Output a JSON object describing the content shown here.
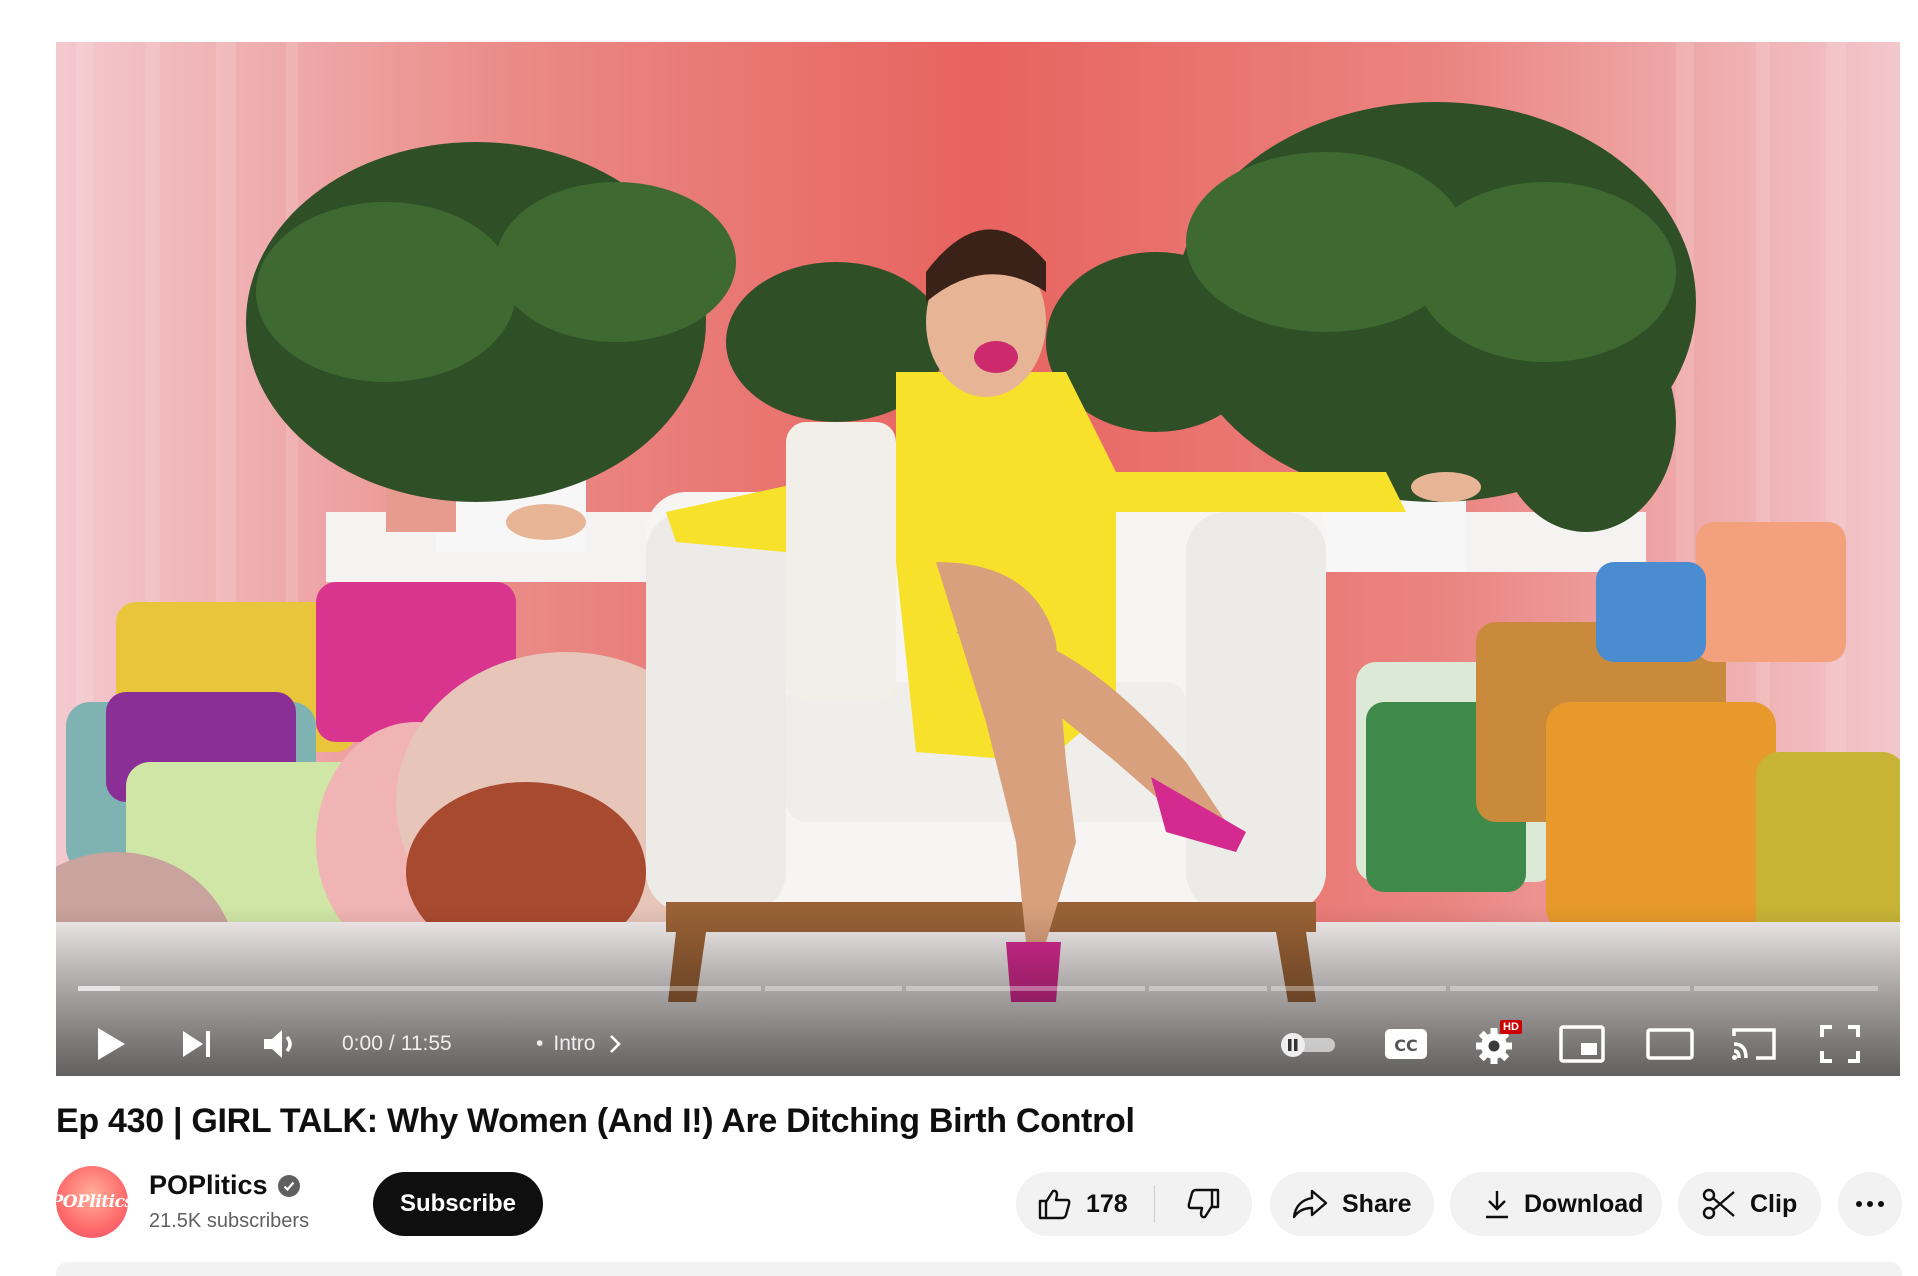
{
  "player": {
    "current_time": "0:00",
    "separator": "/",
    "duration": "11:55",
    "chapter_bullet": "•",
    "chapter": "Intro",
    "progress_played_fraction": 0.0,
    "settings_badge": "HD"
  },
  "video": {
    "title": "Ep 430 | GIRL TALK: Why Women (And I!) Are Ditching Birth Control"
  },
  "channel": {
    "name": "POPlitics",
    "subscribers": "21.5K subscribers",
    "avatar_text": "POPlitics",
    "verified": true
  },
  "actions": {
    "subscribe_label": "Subscribe",
    "like_count": "178",
    "share_label": "Share",
    "download_label": "Download",
    "clip_label": "Clip"
  },
  "icons": {
    "play": "play-icon",
    "next": "next-icon",
    "volume": "volume-icon",
    "autoplay": "autoplay-toggle-icon",
    "cc": "captions-icon",
    "settings": "gear-icon",
    "miniplayer": "miniplayer-icon",
    "theater": "theater-icon",
    "cast": "cast-icon",
    "fullscreen": "fullscreen-icon",
    "like": "thumbs-up-icon",
    "dislike": "thumbs-down-icon",
    "share": "share-arrow-icon",
    "download": "download-icon",
    "clip": "scissors-icon",
    "more": "more-dots-icon"
  },
  "colors": {
    "subscribe_bg": "#0f0f0f",
    "pill_bg": "#f2f2f2",
    "hd_badge": "#cc0000",
    "backdrop": "#e86a66"
  }
}
